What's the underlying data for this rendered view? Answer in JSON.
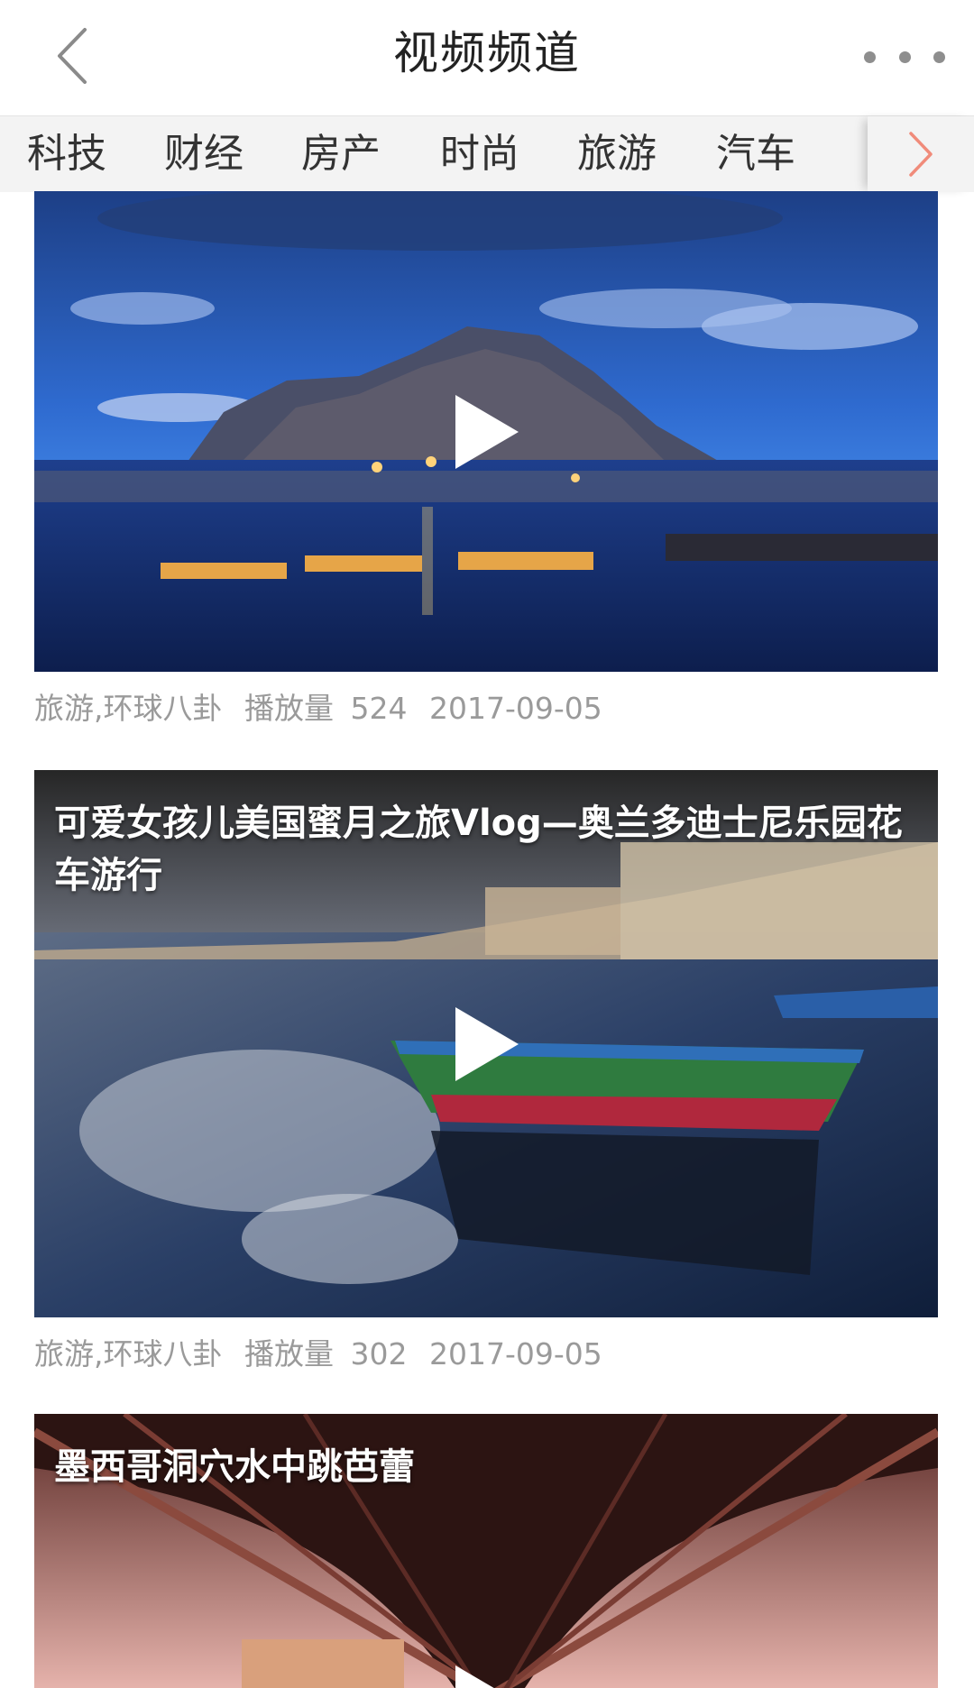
{
  "header": {
    "title": "视频频道",
    "back_icon": "chevron-left-icon",
    "more_icon": "more-dots-icon"
  },
  "categories": {
    "items": [
      {
        "label": "科技"
      },
      {
        "label": "财经"
      },
      {
        "label": "房产"
      },
      {
        "label": "时尚"
      },
      {
        "label": "旅游"
      },
      {
        "label": "汽车"
      }
    ],
    "more_icon": "chevron-right-icon",
    "more_color": "#f08b7a"
  },
  "videos": [
    {
      "title": "",
      "tags": "旅游,环球八卦",
      "plays_label": "播放量",
      "plays": "524",
      "date": "2017-09-05"
    },
    {
      "title": "可爱女孩儿美国蜜月之旅Vlog—奥兰多迪士尼乐园花车游行",
      "tags": "旅游,环球八卦",
      "plays_label": "播放量",
      "plays": "302",
      "date": "2017-09-05"
    },
    {
      "title": "墨西哥洞穴水中跳芭蕾",
      "tags": "",
      "plays_label": "",
      "plays": "",
      "date": ""
    }
  ],
  "colors": {
    "text_primary": "#222222",
    "text_meta": "#9a9a9a",
    "category_bar_bg": "#f3f3f3",
    "accent": "#f08b7a"
  }
}
